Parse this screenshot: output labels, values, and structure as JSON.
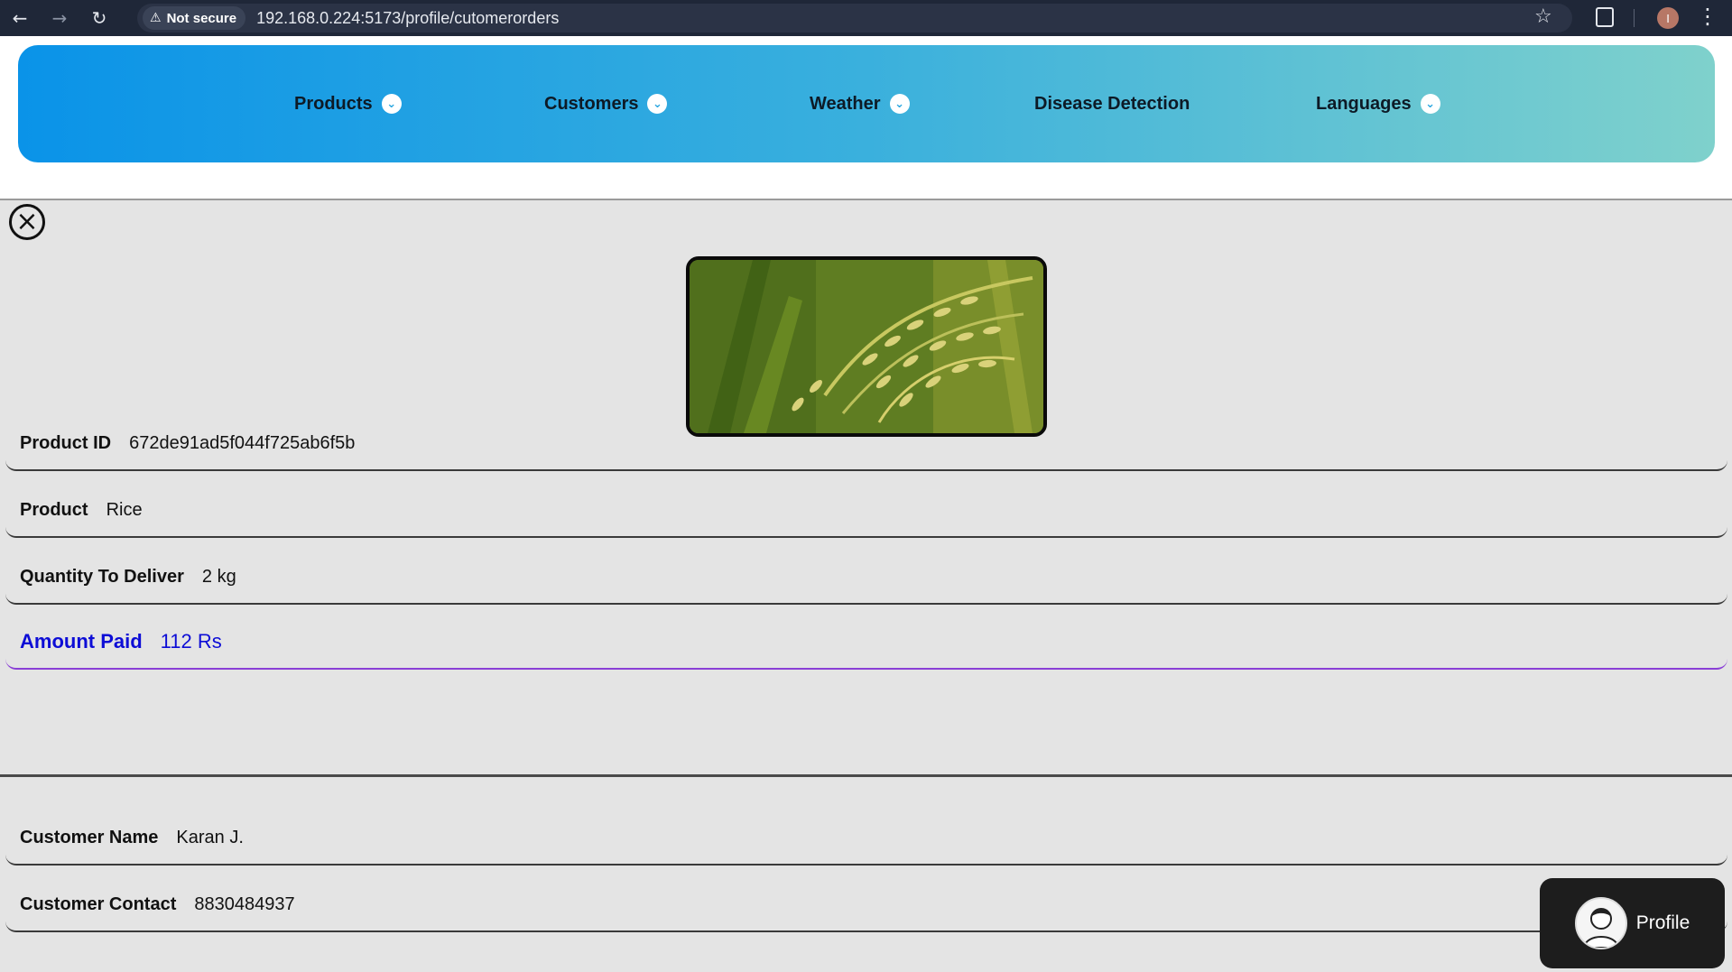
{
  "browser": {
    "security_label": "Not secure",
    "url": "192.168.0.224:5173/profile/cutomerorders",
    "profile_initial": "I"
  },
  "nav": {
    "items": [
      {
        "label": "Products",
        "has_dropdown": true
      },
      {
        "label": "Customers",
        "has_dropdown": true
      },
      {
        "label": "Weather",
        "has_dropdown": true
      },
      {
        "label": "Disease Detection",
        "has_dropdown": false
      },
      {
        "label": "Languages",
        "has_dropdown": true
      }
    ]
  },
  "order": {
    "product_id_label": "Product ID",
    "product_id": "672de91ad5f044f725ab6f5b",
    "product_label": "Product",
    "product": "Rice",
    "quantity_label": "Quantity To Deliver",
    "quantity": "2 kg",
    "amount_label": "Amount Paid",
    "amount": "112 Rs"
  },
  "customer": {
    "name_label": "Customer Name",
    "name": "Karan J.",
    "contact_label": "Customer Contact",
    "contact": "8830484937"
  },
  "profile_button": {
    "label": "Profile"
  },
  "colors": {
    "accent_start": "#0a93e8",
    "accent_end": "#7fd1cc",
    "paid_text": "#0d0dd6",
    "paid_underline": "#8a3fd6"
  }
}
